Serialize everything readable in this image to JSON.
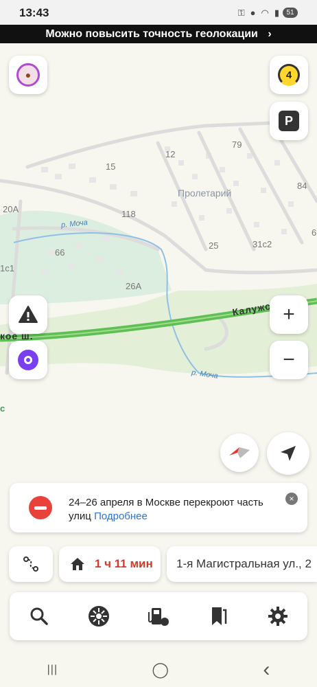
{
  "status_bar": {
    "time": "13:43",
    "battery": "51"
  },
  "geo_banner": {
    "text": "Можно повысить точность геолокации",
    "chevron": "›"
  },
  "map": {
    "labels": {
      "n15": "15",
      "n12": "12",
      "n79": "79",
      "n84": "84",
      "proletariy": "Пролетарий",
      "n20a": "20А",
      "n118": "118",
      "n66": "66",
      "n25": "25",
      "n31c2": "31с2",
      "n1c1": "1с1",
      "n26a": "26А",
      "n6": "6",
      "c": "с"
    },
    "river_1": "р. Моча",
    "river_2": "р. Моча",
    "road_1": "Калужское ш",
    "road_2": "кое ш."
  },
  "buttons": {
    "layers_badge": "4",
    "parking_label": "P",
    "zoom_in": "+",
    "zoom_out": "−"
  },
  "notice": {
    "text": "24–26 апреля в Москве перекроют часть улиц",
    "link": "Подробнее",
    "close": "×"
  },
  "route_bar": {
    "travel_time": "1 ч 11 мин",
    "address": "1-я Магистральная ул., 2"
  },
  "nav_bar": {
    "recents": "|||",
    "home": "◯",
    "back": "‹"
  }
}
